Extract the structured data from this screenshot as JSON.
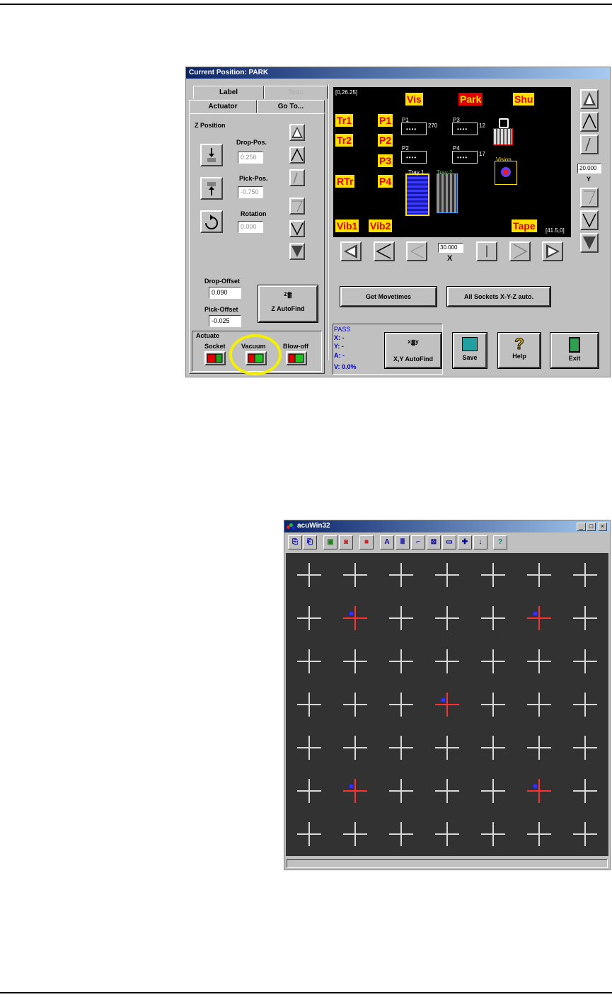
{
  "window1": {
    "title": "Current Position: PARK",
    "tabs": [
      "Label",
      "Teac",
      "Actuator",
      "Go To..."
    ],
    "z_position": {
      "group": "Z Position",
      "drop_pos_label": "Drop-Pos.",
      "drop_pos_value": "0.250",
      "pick_pos_label": "Pick-Pos.",
      "pick_pos_value": "-0.750",
      "rotation_label": "Rotation",
      "rotation_value": "0.000",
      "drop_offset_label": "Drop-Offset",
      "drop_offset_value": "0.090",
      "pick_offset_label": "Pick-Offset",
      "pick_offset_value": "-0.025",
      "autofind_label": "Z AutoFind"
    },
    "actuate": {
      "group": "Actuate",
      "socket": "Socket",
      "vacuum": "Vacuum",
      "blowoff": "Blow-off"
    },
    "canvas": {
      "coord_top": "[0,26.25]",
      "coord_bottom": "[41.5,0]",
      "labels": [
        "Vis",
        "Park",
        "Shu",
        "Tr1",
        "Tr2",
        "RTr",
        "P1",
        "P2",
        "P3",
        "P4",
        "Vib1",
        "Vib2",
        "Tape"
      ],
      "sockets": [
        "P1",
        "P3",
        "P2",
        "P4"
      ],
      "socket_notes": [
        "270",
        "12",
        "17"
      ],
      "tray1": "Tray 1",
      "tray2": "Tray 2",
      "vision": "Vision"
    },
    "x_value": "30.000",
    "x_label": "X",
    "y_value": "20.000",
    "y_label": "Y",
    "get_movetimes": "Get Movetimes",
    "all_sockets": "All Sockets X-Y-Z auto.",
    "status": {
      "pass": "PASS",
      "x": "X: -",
      "y": "Y: -",
      "a": "A: -",
      "v": "V: 0.0%"
    },
    "xy_autofind": "X,Y AutoFind",
    "save": "Save",
    "help": "Help",
    "exit": "Exit"
  },
  "window2": {
    "title": "acuWin32",
    "toolbar_icons": [
      "open-icon",
      "save-image-icon",
      "camera-icon",
      "camera-record-icon",
      "color-icon",
      "text-a-icon",
      "bars-icon",
      "corner-icon",
      "box-icon",
      "line-icon",
      "crosshair-icon",
      "arrow-down-icon",
      "help-icon"
    ],
    "toolbar_glyphs": [
      "⎘",
      "⎗",
      "▣",
      "◙",
      "■",
      "A",
      "Ⅲ",
      "⌐",
      "⊠",
      "▭",
      "✚",
      "↓",
      "?"
    ],
    "grid": {
      "rows": 7,
      "cols": 7,
      "markers": [
        [
          1,
          1
        ],
        [
          1,
          5
        ],
        [
          3,
          3
        ],
        [
          5,
          1
        ],
        [
          5,
          5
        ]
      ]
    }
  },
  "colors": {
    "highlight_circle": "#f5f000",
    "titlebar": "#0a246a",
    "canvas_label_bg": "#ffe000",
    "canvas_label_fg": "#e00000"
  }
}
